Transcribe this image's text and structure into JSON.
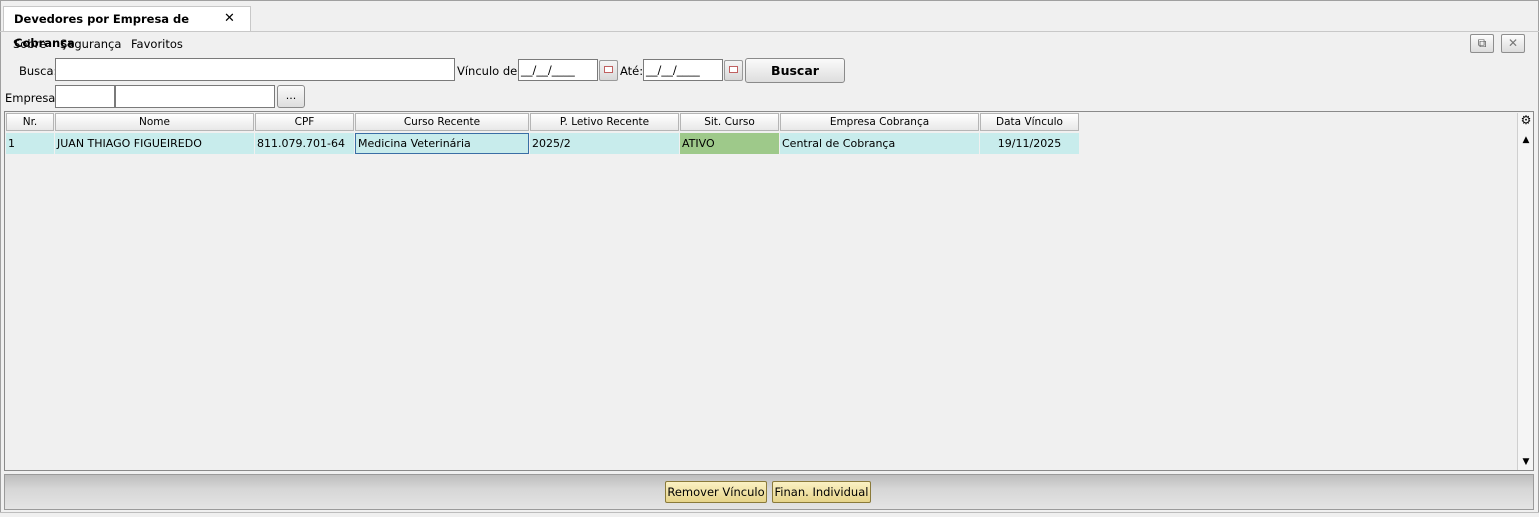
{
  "tab": {
    "title": "Devedores por Empresa de Cobrança"
  },
  "menu": {
    "items": [
      "Sobre",
      "Segurança",
      "Favoritos"
    ]
  },
  "form": {
    "busca_label": "Busca:",
    "busca_value": "",
    "vinculo_label": "Vínculo de:",
    "vinculo_de_value": "__/__/____",
    "ate_label": "Até:",
    "ate_value": "__/__/____",
    "buscar_label": "Buscar",
    "empresa_label": "Empresa:",
    "empresa_code": "",
    "empresa_name": "",
    "lookup_label": "..."
  },
  "table": {
    "columns": [
      "Nr.",
      "Nome",
      "CPF",
      "Curso Recente",
      "P. Letivo Recente",
      "Sit. Curso",
      "Empresa Cobrança",
      "Data Vínculo"
    ],
    "rows": [
      {
        "nr": "1",
        "nome": "JUAN THIAGO FIGUEIREDO",
        "cpf": "811.079.701-64",
        "curso": "Medicina Veterinária",
        "periodo": "2025/2",
        "situacao": "ATIVO",
        "empresa": "Central de Cobrança",
        "data": "19/11/2025"
      }
    ]
  },
  "actions": {
    "remover": "Remover Vínculo",
    "finan": "Finan. Individual"
  },
  "colors": {
    "row_bg": "#c8ecec",
    "status_ativo": "#9ec98a",
    "action_button": "#f0e2a0"
  }
}
